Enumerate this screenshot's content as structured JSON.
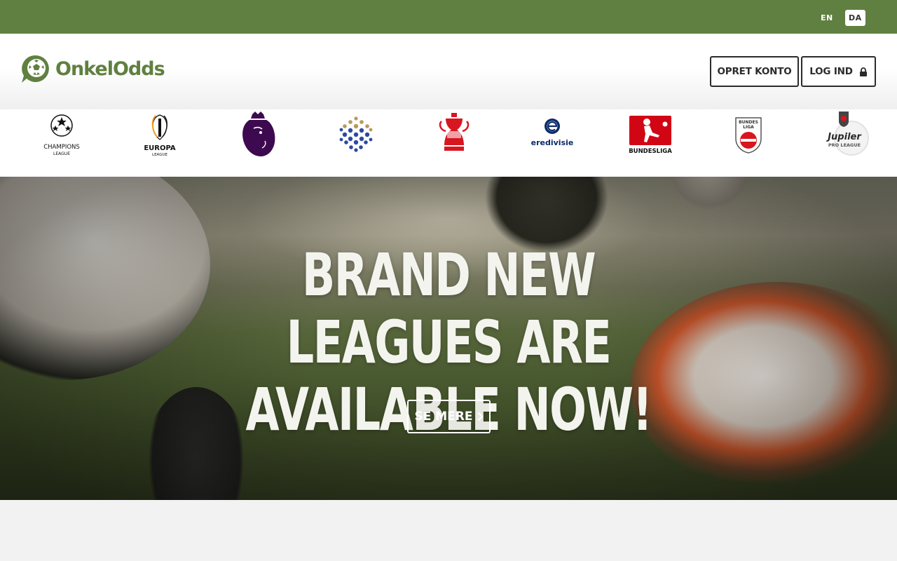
{
  "topbar": {
    "languages": [
      {
        "code": "EN",
        "active": false
      },
      {
        "code": "DA",
        "active": true
      }
    ],
    "background_color": "#5f8040"
  },
  "header": {
    "brand": "OnkelOdds",
    "brand_color": "#5f8040",
    "create_account_label": "OPRET KONTO",
    "login_label": "LOG IND",
    "login_icon": "lock-icon"
  },
  "leagues": {
    "champions_league": {
      "lines": [
        "CHAMPIONS",
        "LEAGUE"
      ]
    },
    "europa_league": {
      "lines": [
        "EUROPA",
        "LEAGUE"
      ]
    },
    "premier_league": {
      "icon": "premier-league-lion-icon"
    },
    "superliga": {
      "icon": "superliga-dots-icon"
    },
    "fa_cup": {
      "icon": "fa-cup-trophy-icon"
    },
    "eredivisie": {
      "text": "eredivisie"
    },
    "bundesliga": {
      "text": "BUNDESLIGA"
    },
    "austrian_bundesliga": {
      "lines": [
        "BUNDES",
        "LIGA"
      ]
    },
    "jupiler_pro_league": {
      "lines": [
        "Jupiler",
        "PRO LEAGUE"
      ]
    }
  },
  "hero": {
    "title_line1": "BRAND NEW LEAGUES ARE",
    "title_line2": "AVAILABLE NOW!",
    "cta_label": "SE MERE",
    "cta_icon": "chevron-right-icon"
  }
}
